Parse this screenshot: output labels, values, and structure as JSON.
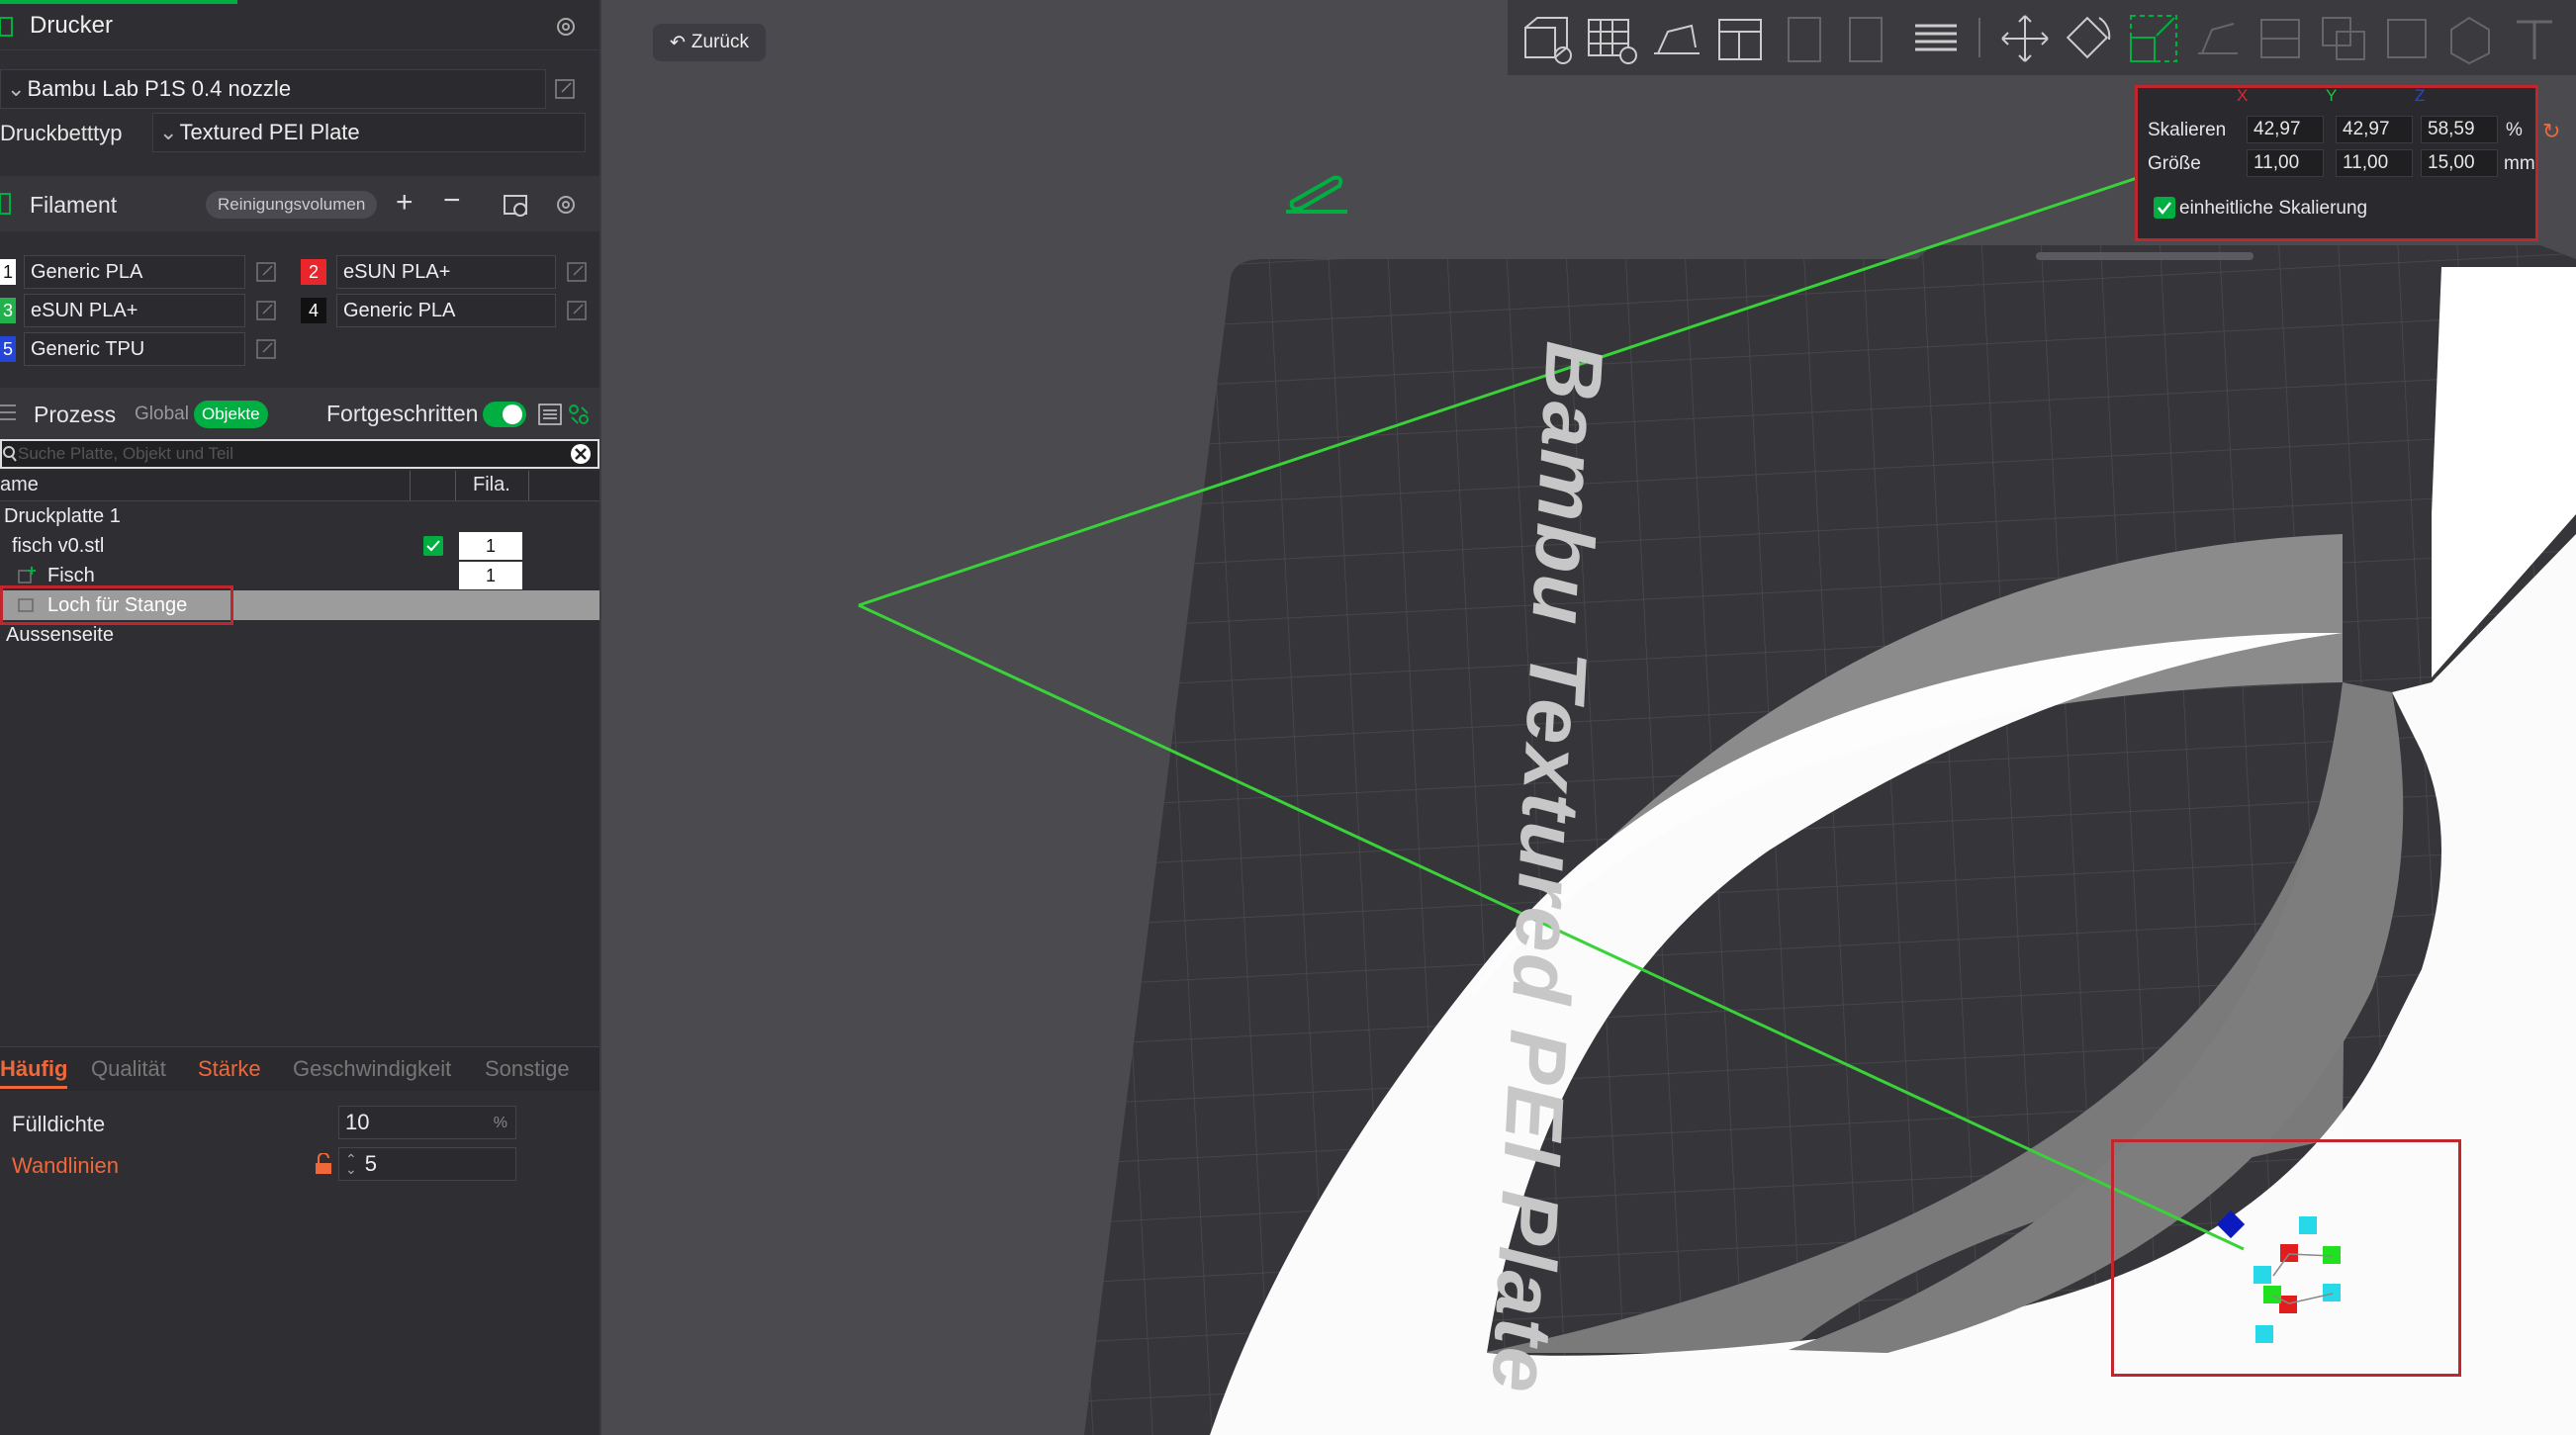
{
  "printer": {
    "title": "Drucker",
    "name": "Bambu Lab P1S 0.4 nozzle",
    "bed_label": "Druckbetttyp",
    "bed_value": "Textured PEI Plate"
  },
  "filament": {
    "title": "Filament",
    "flush_button": "Reinigungsvolumen",
    "slots": [
      {
        "num": "1",
        "name": "Generic PLA",
        "color": "#ffffff",
        "numColor": "#111111"
      },
      {
        "num": "2",
        "name": "eSUN PLA+",
        "color": "#e8262b",
        "numColor": "#ffffff"
      },
      {
        "num": "3",
        "name": "eSUN PLA+",
        "color": "#22b14c",
        "numColor": "#ffffff"
      },
      {
        "num": "4",
        "name": "Generic PLA",
        "color": "#111111",
        "numColor": "#ffffff"
      },
      {
        "num": "5",
        "name": "Generic TPU",
        "color": "#2345d8",
        "numColor": "#ffffff"
      }
    ]
  },
  "process": {
    "title": "Prozess",
    "global": "Global",
    "objects": "Objekte",
    "advanced": "Fortgeschritten",
    "search_placeholder": "Suche Platte, Objekt und Teil"
  },
  "object_list": {
    "col_name": "ame",
    "col_fila": "Fila.",
    "rows": [
      {
        "label": "Druckplatte 1"
      },
      {
        "label": "fisch v0.stl",
        "fila": "1"
      },
      {
        "label": "Fisch",
        "fila": "1"
      },
      {
        "label": "Loch für Stange"
      },
      {
        "label": "Aussenseite"
      }
    ]
  },
  "tabs": {
    "frequent": "Häufig",
    "quality": "Qualität",
    "strength": "Stärke",
    "speed": "Geschwindigkeit",
    "other": "Sonstige"
  },
  "settings": {
    "infill_label": "Fülldichte",
    "infill_value": "10",
    "infill_unit": "%",
    "walls_label": "Wandlinien",
    "walls_value": "5"
  },
  "viewport": {
    "back_button": "Zurück",
    "plate_text": "Bambu Textured PEI Plate",
    "scale_panel": {
      "axis_x": "X",
      "axis_y": "Y",
      "axis_z": "Z",
      "scale_label": "Skalieren",
      "scale_x": "42,97",
      "scale_y": "42,97",
      "scale_z": "58,59",
      "scale_unit": "%",
      "size_label": "Größe",
      "size_x": "11,00",
      "size_y": "11,00",
      "size_z": "15,00",
      "size_unit": "mm",
      "uniform_label": "einheitliche Skalierung"
    }
  },
  "colors": {
    "accent": "#00ae42",
    "highlight": "#f0683a",
    "annotation_red": "#c0262d"
  }
}
